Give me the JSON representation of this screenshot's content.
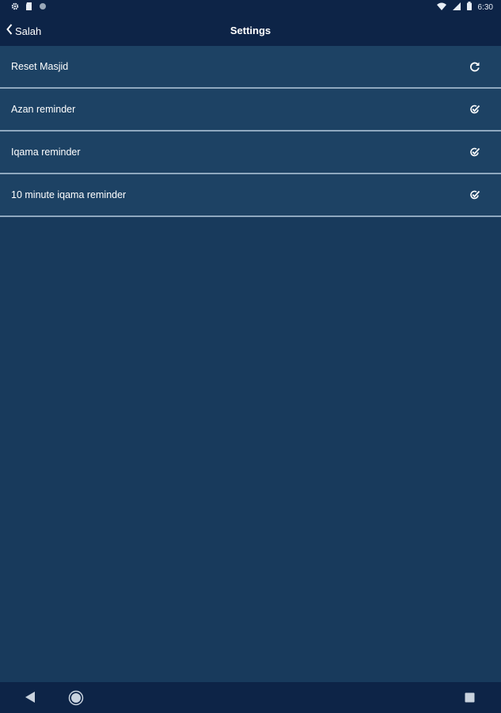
{
  "status_bar": {
    "left_icons": [
      "settings-icon",
      "sd-card-icon",
      "circle-notification-icon"
    ],
    "right_icons": [
      "wifi-icon",
      "cellular-signal-icon",
      "battery-icon"
    ],
    "time": "6:30"
  },
  "app_bar": {
    "back_label": "Salah",
    "title": "Settings"
  },
  "settings": {
    "items": [
      {
        "label": "Reset Masjid",
        "icon": "refresh-icon"
      },
      {
        "label": "Azan reminder",
        "icon": "check-circle-icon"
      },
      {
        "label": "Iqama reminder",
        "icon": "check-circle-icon"
      },
      {
        "label": "10 minute iqama reminder",
        "icon": "check-circle-icon"
      }
    ]
  },
  "nav_bar": {
    "icons": [
      "back-triangle-icon",
      "home-circle-icon",
      "recents-square-icon"
    ]
  },
  "colors": {
    "background": "#183a5c",
    "bar": "#0d2447",
    "row": "#1d4264",
    "divider": "#8fa8bf",
    "text": "#ffffff"
  }
}
